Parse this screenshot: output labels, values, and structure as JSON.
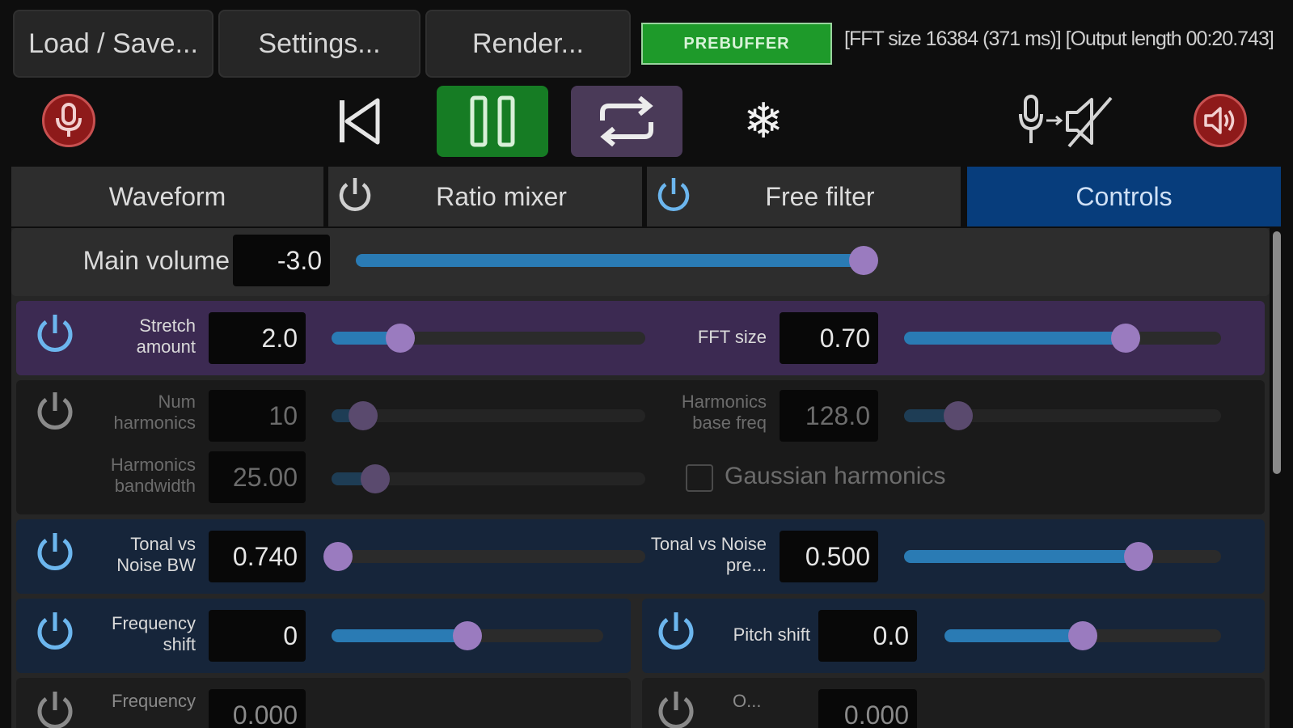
{
  "toolbar": {
    "load_save": "Load / Save...",
    "settings": "Settings...",
    "render": "Render...",
    "prebuffer": "PREBUFFER",
    "info": "[FFT size 16384 (371 ms)] [Output length 00:20.743]"
  },
  "transport": {
    "record_icon": "microphone-icon",
    "rewind_icon": "rewind-to-start-icon",
    "pause_icon": "pause-icon",
    "loop_icon": "loop-icon",
    "freeze_icon": "snowflake-icon",
    "input_to_mute_icon": "mic-to-mute-icon",
    "speaker_icon": "speaker-icon"
  },
  "tabs": [
    {
      "label": "Waveform"
    },
    {
      "label": "Ratio mixer"
    },
    {
      "label": "Free filter"
    },
    {
      "label": "Controls"
    }
  ],
  "controls": {
    "main_volume": {
      "label": "Main volume",
      "value": "-3.0",
      "level": 0.99
    },
    "stretch_amount": {
      "label": "Stretch amount",
      "value": "2.0",
      "level": 0.22
    },
    "fft_size": {
      "label": "FFT size",
      "value": "0.70",
      "level": 0.7
    },
    "num_harmonics": {
      "label": "Num harmonics",
      "value": "10",
      "level": 0.1
    },
    "harmonics_base_freq": {
      "label": "Harmonics base freq",
      "value": "128.0",
      "level": 0.17
    },
    "harmonics_bandwidth": {
      "label": "Harmonics bandwidth",
      "value": "25.00",
      "level": 0.14
    },
    "gaussian_harmonics": {
      "label": "Gaussian harmonics",
      "checked": false
    },
    "tonal_noise_bw": {
      "label": "Tonal vs Noise BW",
      "value": "0.740",
      "level": 0.02
    },
    "tonal_noise_preserve": {
      "label": "Tonal vs Noise pre...",
      "value": "0.500",
      "level": 0.74
    },
    "frequency_shift": {
      "label": "Frequency shift",
      "value": "0",
      "level": 0.5
    },
    "pitch_shift": {
      "label": "Pitch shift",
      "value": "0.0",
      "level": 0.5
    },
    "partial_left": {
      "label": "Frequency",
      "value": "0.000"
    },
    "partial_right": {
      "label": "O...",
      "value": "0.000"
    }
  },
  "colors": {
    "accent_blue": "#2a7bb4",
    "thumb_purple": "#9a7bbf",
    "prebuffer_green": "#1e9a2a",
    "active_tab": "#073d7c",
    "stretch_row": "#3c2a52",
    "tonal_row": "#16253a"
  }
}
